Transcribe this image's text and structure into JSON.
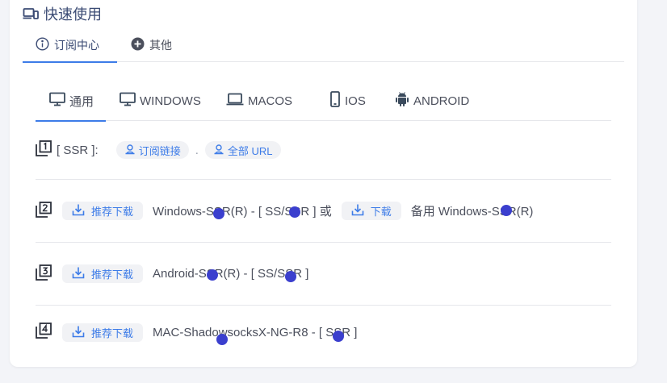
{
  "card": {
    "title": "快速使用"
  },
  "top_tabs": [
    {
      "label": "订阅中心",
      "icon": "info-circle-icon",
      "active": true
    },
    {
      "label": "其他",
      "icon": "plus-circle-icon",
      "active": false
    }
  ],
  "os_tabs": [
    {
      "label": "通用",
      "icon": "monitor-icon",
      "active": true
    },
    {
      "label": "WINDOWS",
      "icon": "monitor-icon",
      "active": false
    },
    {
      "label": "MACOS",
      "icon": "laptop-icon",
      "active": false
    },
    {
      "label": "IOS",
      "icon": "phone-icon",
      "active": false
    },
    {
      "label": "ANDROID",
      "icon": "android-icon",
      "active": false
    }
  ],
  "rows": {
    "r1": {
      "step_icon": "step-1-icon",
      "label": "[ SSR ]:",
      "sub_link": "订阅链接",
      "separator": ".",
      "all_url": "全部 URL"
    },
    "r2": {
      "step_icon": "step-2-icon",
      "download_btn": "推荐下载",
      "app_name": "Windows-SSR(R) - [ SS/SSR ] 或",
      "alt_download_btn": "下载",
      "alt_app_name": "备用 Windows-SSR(R)"
    },
    "r3": {
      "step_icon": "step-3-icon",
      "download_btn": "推荐下载",
      "app_name": "Android-SSR(R) - [ SS/SSR ]"
    },
    "r4": {
      "step_icon": "step-4-icon",
      "download_btn": "推荐下载",
      "app_name": "MAC-ShadowsocksX-NG-R8 - [ SSR ]"
    }
  },
  "colors": {
    "accent": "#3d7ce8",
    "title": "#3a4a73",
    "text": "#4b4f5c",
    "marker_dot": "#3b3fce"
  }
}
